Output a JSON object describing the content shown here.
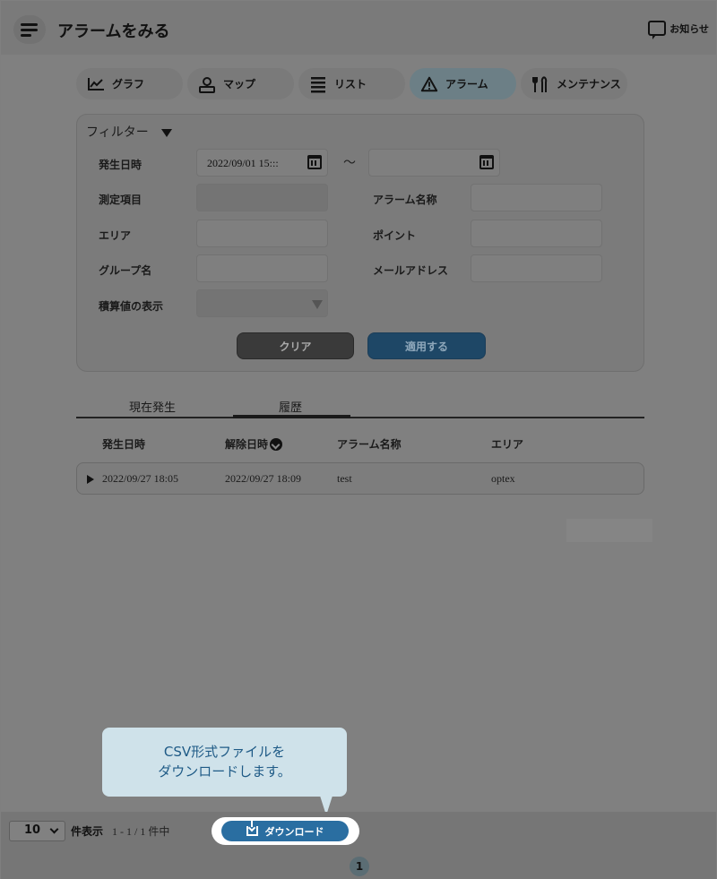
{
  "header": {
    "title": "アラームをみる",
    "notice_label": "お知らせ"
  },
  "tabs": [
    {
      "label": "グラフ",
      "icon": "chart-line-icon"
    },
    {
      "label": "マップ",
      "icon": "map-pin-icon"
    },
    {
      "label": "リスト",
      "icon": "list-icon"
    },
    {
      "label": "アラーム",
      "icon": "warning-icon",
      "active": true
    },
    {
      "label": "メンテナンス",
      "icon": "tools-icon"
    }
  ],
  "filter": {
    "title": "フィルター",
    "date_label": "発生日時",
    "date_from": "2022/09/01 15:::",
    "date_to": "",
    "tilde": "～",
    "measure_label": "測定項目",
    "measure_value": "",
    "alarm_name_label": "アラーム名称",
    "alarm_name_value": "",
    "area_label": "エリア",
    "area_value": "",
    "point_label": "ポイント",
    "point_value": "",
    "group_label": "グループ名",
    "group_value": "",
    "mail_label": "メールアドレス",
    "mail_value": "",
    "integrated_label": "積算値の表示",
    "integrated_value": "",
    "clear_button": "クリア",
    "apply_button": "適用する"
  },
  "subtabs": {
    "current": "現在発生",
    "history": "履歴"
  },
  "table": {
    "headers": [
      "発生日時",
      "解除日時",
      "アラーム名称",
      "エリア"
    ],
    "rows": [
      {
        "occurred": "2022/09/27 18:05",
        "released": "2022/09/27 18:09",
        "name": "test",
        "area": "optex"
      }
    ]
  },
  "footer": {
    "per_page": "10",
    "per_page_label": "件表示",
    "range": "1 - 1 / 1 件中",
    "download_button": "ダウンロード",
    "page": "1"
  },
  "tooltip": {
    "line1": "CSV形式ファイルを",
    "line2": "ダウンロードします。"
  },
  "colors": {
    "accent": "#2a6ea1",
    "tooltip_bg": "#cfe2ea",
    "tooltip_text": "#1e5a86"
  }
}
